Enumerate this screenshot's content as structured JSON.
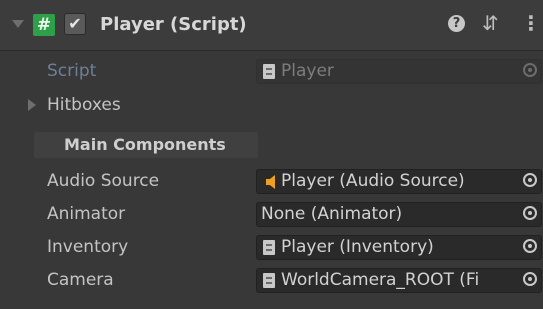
{
  "header": {
    "title": "Player (Script)",
    "script_icon_glyph": "#",
    "enabled_check_glyph": "✔",
    "help_glyph": "?",
    "presets_glyph": "⇵",
    "menu_glyph": "⋮"
  },
  "script_row": {
    "label": "Script",
    "value": "Player"
  },
  "hitboxes": {
    "label": "Hitboxes"
  },
  "section": {
    "label": "Main Components"
  },
  "fields": [
    {
      "label": "Audio Source",
      "value": "Player (Audio Source)",
      "icon": "audio-source-icon"
    },
    {
      "label": "Animator",
      "value": "None (Animator)",
      "icon": ""
    },
    {
      "label": "Inventory",
      "value": "Player (Inventory)",
      "icon": "script-file-icon"
    },
    {
      "label": "Camera",
      "value": "WorldCamera_ROOT (Fi",
      "icon": "script-file-icon"
    }
  ],
  "colors": {
    "script_green": "#2fa04a",
    "audio_orange": "#f0a020",
    "panel_bg": "#383838"
  }
}
